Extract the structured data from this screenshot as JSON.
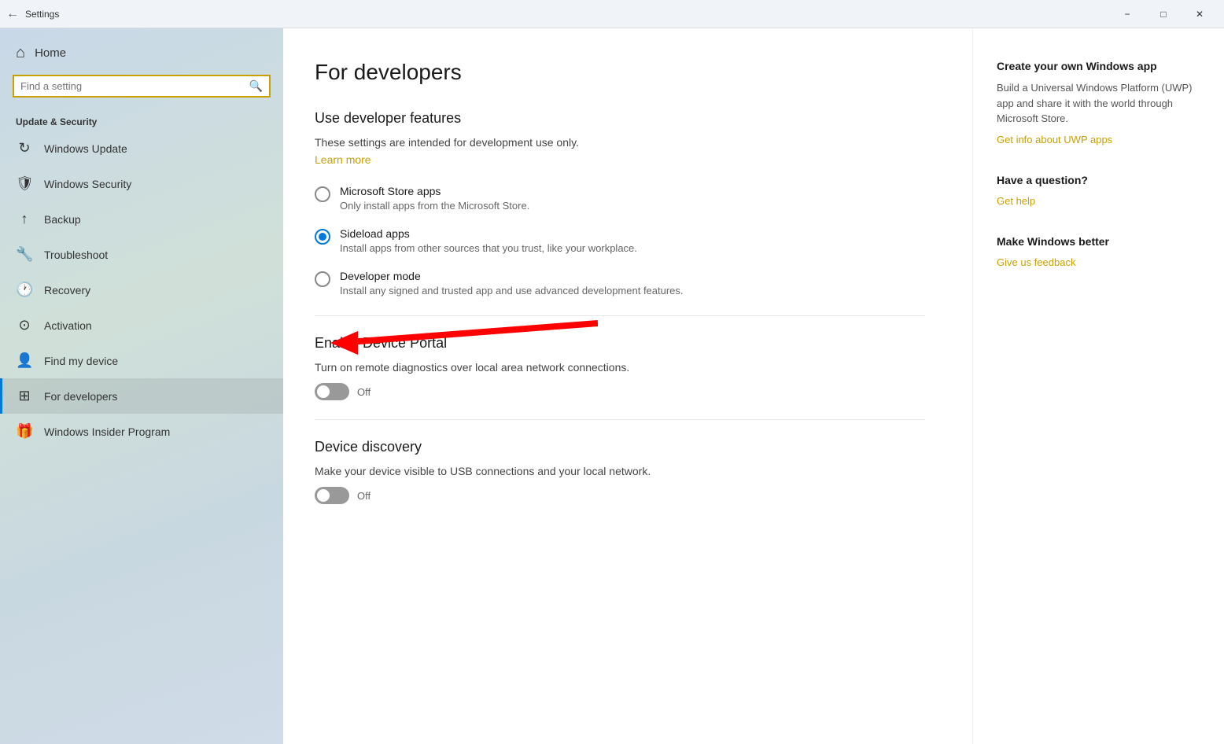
{
  "titleBar": {
    "title": "Settings",
    "backIcon": "←",
    "minimizeLabel": "−",
    "maximizeLabel": "□",
    "closeLabel": "✕"
  },
  "sidebar": {
    "homeLabel": "Home",
    "searchPlaceholder": "Find a setting",
    "sectionHeader": "Update & Security",
    "navItems": [
      {
        "id": "windows-update",
        "icon": "↻",
        "label": "Windows Update",
        "active": false
      },
      {
        "id": "windows-security",
        "icon": "🛡",
        "label": "Windows Security",
        "active": false
      },
      {
        "id": "backup",
        "icon": "↑",
        "label": "Backup",
        "active": false
      },
      {
        "id": "troubleshoot",
        "icon": "🔧",
        "label": "Troubleshoot",
        "active": false
      },
      {
        "id": "recovery",
        "icon": "🕐",
        "label": "Recovery",
        "active": false
      },
      {
        "id": "activation",
        "icon": "⊙",
        "label": "Activation",
        "active": false
      },
      {
        "id": "find-device",
        "icon": "👤",
        "label": "Find my device",
        "active": false
      },
      {
        "id": "for-developers",
        "icon": "⊞",
        "label": "For developers",
        "active": true
      },
      {
        "id": "windows-insider",
        "icon": "🎁",
        "label": "Windows Insider Program",
        "active": false
      }
    ]
  },
  "main": {
    "pageTitle": "For developers",
    "sectionTitle": "Use developer features",
    "descriptionText": "These settings are intended for development use only.",
    "learnMoreLabel": "Learn more",
    "radioOptions": [
      {
        "id": "microsoft-store",
        "label": "Microsoft Store apps",
        "description": "Only install apps from the Microsoft Store.",
        "selected": false
      },
      {
        "id": "sideload-apps",
        "label": "Sideload apps",
        "description": "Install apps from other sources that you trust, like your workplace.",
        "selected": true
      },
      {
        "id": "developer-mode",
        "label": "Developer mode",
        "description": "Install any signed and trusted app and use advanced development features.",
        "selected": false
      }
    ],
    "enableDevPortal": {
      "title": "Enable Device Portal",
      "description": "Turn on remote diagnostics over local area network connections.",
      "toggleState": "off",
      "toggleLabel": "Off"
    },
    "deviceDiscovery": {
      "title": "Device discovery",
      "description": "Make your device visible to USB connections and your local network.",
      "toggleState": "off",
      "toggleLabel": "Off"
    }
  },
  "rightPanel": {
    "sections": [
      {
        "id": "create-app",
        "title": "Create your own Windows app",
        "description": "Build a Universal Windows Platform (UWP) app and share it with the world through Microsoft Store.",
        "linkLabel": "Get info about UWP apps"
      },
      {
        "id": "have-question",
        "title": "Have a question?",
        "description": "",
        "linkLabel": "Get help"
      },
      {
        "id": "make-better",
        "title": "Make Windows better",
        "description": "",
        "linkLabel": "Give us feedback"
      }
    ]
  }
}
